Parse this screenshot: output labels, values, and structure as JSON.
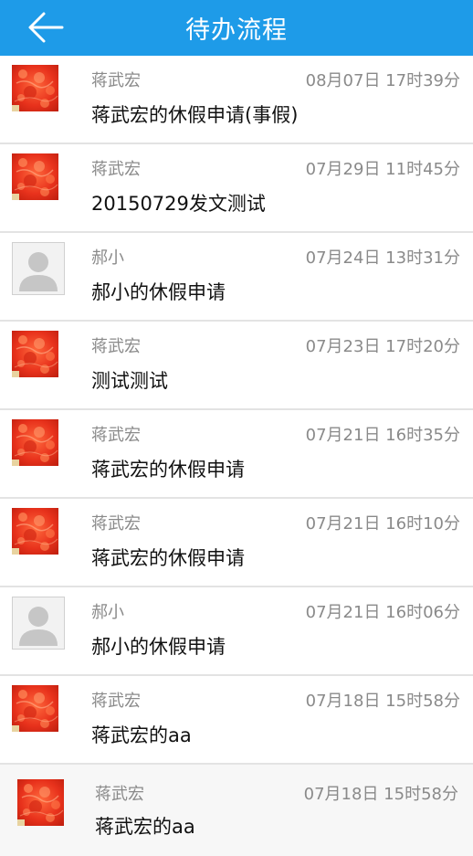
{
  "header": {
    "title": "待办流程",
    "back_icon": "arrow-left-icon",
    "background": "#1e9be8"
  },
  "items": [
    {
      "name": "蒋武宏",
      "time": "08月07日 17时39分",
      "subject": "蒋武宏的休假申请(事假)",
      "avatar": "red-photo"
    },
    {
      "name": "蒋武宏",
      "time": "07月29日 11时45分",
      "subject": "20150729发文测试",
      "avatar": "red-photo"
    },
    {
      "name": "郝小",
      "time": "07月24日 13时31分",
      "subject": "郝小的休假申请",
      "avatar": "default-person"
    },
    {
      "name": "蒋武宏",
      "time": "07月23日 17时20分",
      "subject": "测试测试",
      "avatar": "red-photo"
    },
    {
      "name": "蒋武宏",
      "time": "07月21日 16时35分",
      "subject": "蒋武宏的休假申请",
      "avatar": "red-photo"
    },
    {
      "name": "蒋武宏",
      "time": "07月21日 16时10分",
      "subject": "蒋武宏的休假申请",
      "avatar": "red-photo"
    },
    {
      "name": "郝小",
      "time": "07月21日 16时06分",
      "subject": "郝小的休假申请",
      "avatar": "default-person"
    },
    {
      "name": "蒋武宏",
      "time": "07月18日 15时58分",
      "subject": "蒋武宏的aa",
      "avatar": "red-photo"
    },
    {
      "name": "蒋武宏",
      "time": "07月18日 15时58分",
      "subject": "蒋武宏的aa",
      "avatar": "red-photo"
    }
  ]
}
